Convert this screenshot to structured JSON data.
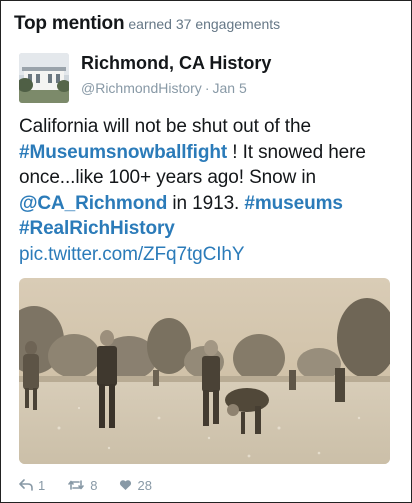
{
  "top_mention": {
    "title": "Top mention",
    "subtitle": "earned 37 engagements"
  },
  "tweet": {
    "author_name": "Richmond, CA History",
    "handle": "@RichmondHistory",
    "separator": "·",
    "date": "Jan 5",
    "text": {
      "part1": "California will not be shut out of the ",
      "hashtag1": "#Museumsnowballfight",
      "part2": " ! It snowed here once...like 100+ years ago! Snow in ",
      "mention1": "@CA_Richmond",
      "part3": " in 1913. ",
      "hashtag2": "#museums",
      "hashtag3": "#RealRichHistory",
      "link": "pic.twitter.com/ZFq7tgCIhY"
    },
    "actions": {
      "replies": "1",
      "retweets": "8",
      "likes": "28"
    }
  },
  "icons": {
    "avatar": "building-photo-icon",
    "reply": "reply-arrow-icon",
    "retweet": "retweet-icon",
    "like": "heart-icon"
  },
  "colors": {
    "link": "#2b7bb9",
    "text": "#14171a",
    "muted": "#8899a6"
  }
}
